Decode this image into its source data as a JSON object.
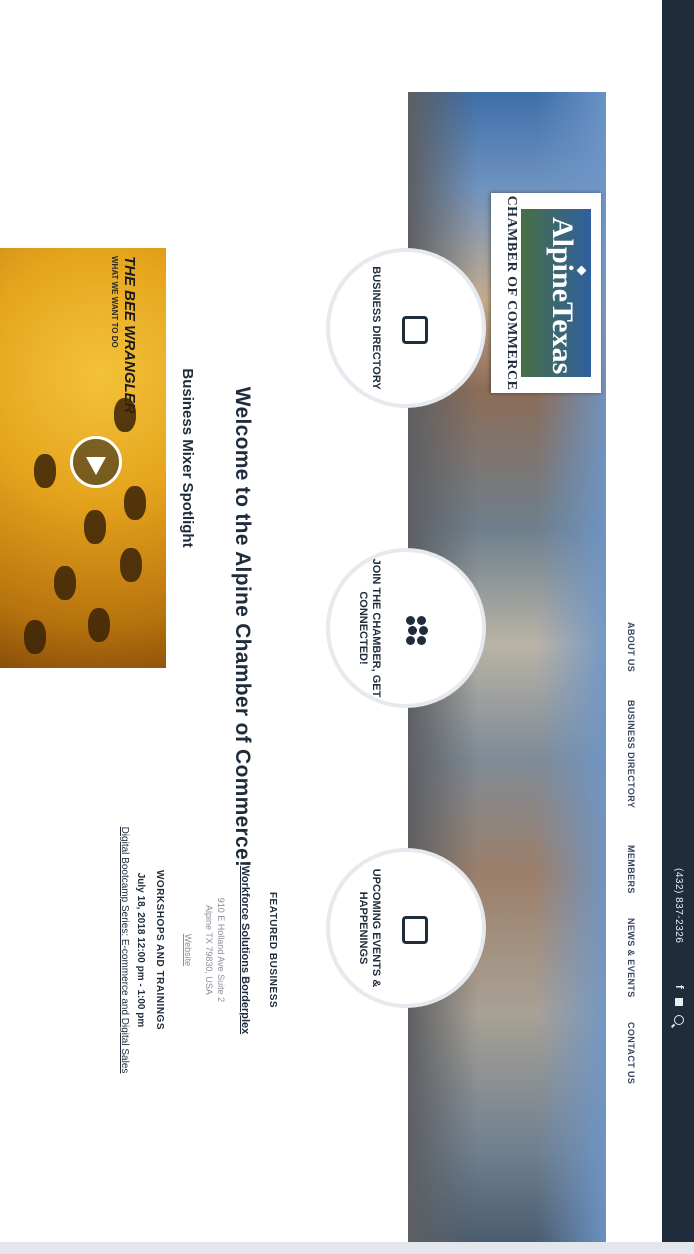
{
  "topbar": {
    "phone": "(432) 837-2326",
    "icons": [
      "facebook-icon",
      "email-icon",
      "search-icon"
    ]
  },
  "nav": {
    "items": [
      {
        "label": "ABOUT US",
        "key": "about"
      },
      {
        "label": "BUSINESS DIRECTORY",
        "key": "directory"
      },
      {
        "label": "MEMBERS",
        "key": "members"
      },
      {
        "label": "NEWS & EVENTS",
        "key": "news"
      },
      {
        "label": "CONTACT US",
        "key": "contact"
      }
    ]
  },
  "logo": {
    "title": "AlpineTexas",
    "subtitle": "CHAMBER OF COMMERCE"
  },
  "circles": [
    {
      "label": "BUSINESS DIRECTORY",
      "icon": "directory-icon"
    },
    {
      "label": "JOIN THE CHAMBER, GET CONNECTED!",
      "icon": "people-icon"
    },
    {
      "label": "UPCOMING EVENTS & HAPPENINGS",
      "icon": "calendar-icon"
    }
  ],
  "welcome": "Welcome to the Alpine Chamber of Commerce!",
  "mixer": {
    "title": "Business Mixer Spotlight",
    "video_title": "THE BEE WRANGLER",
    "video_subtitle": "WHAT WE WANT TO DO"
  },
  "featured": {
    "heading": "FEATURED BUSINESS",
    "name": "Workforce Solutions Borderplex",
    "address_line1": "910 E Holland Ave Suite 2",
    "address_line2": "Alpine TX 79830, USA",
    "website": "Website",
    "workshops_heading": "WORKSHOPS AND TRAININGS",
    "workshop_date": "July 18, 2018 12:00 pm - 1:00 pm",
    "workshop_link": "Digital Bootcamp Series: E-commerce and Digital Sales"
  },
  "colors": {
    "navy": "#1e2c3c",
    "background": "#ffffff",
    "honey": "#e5a41d"
  }
}
